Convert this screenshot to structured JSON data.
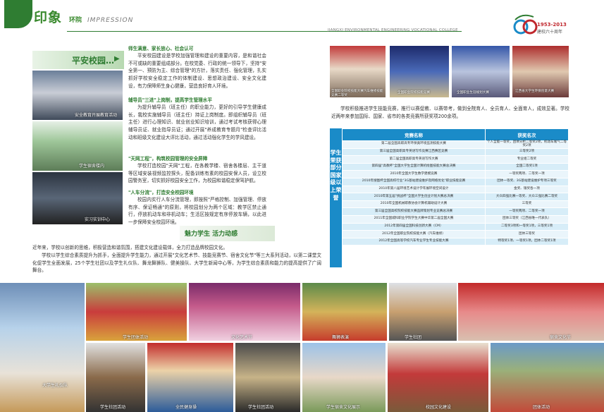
{
  "header": {
    "brand_title": "印象",
    "brand_sub": "环院",
    "brand_impression": "IMPRESSION",
    "college_en": "JIANGXI ENVIRONMENTAL ENGINEERING VOCATIONAL COLLEGE",
    "anniversary_years": "1953-2013",
    "anniversary_text": "建校六十周年"
  },
  "left": {
    "section_heading": "平安校园…",
    "section_arrow": "▶",
    "photo_captions": [
      "安全教育开展教育活动",
      "学生宿舍楼内",
      "实习实训中心"
    ],
    "blocks": [
      {
        "subtitle": "师生满意、家长放心、社会认可",
        "text": "平安校园建设是学校加强管理和建设的重要内容，是和谐社会不可或缺的重要组成部分。在校党委、行政的统一领导下，坚持\"安全第一、预防为主、综合管理\"的方针，落实责任、强化管理，扎实抓好学校安全稳定工作的体制建设、思想政治建设、安全文化建设，有力保障师生身心健康，营造良好育人环境。"
      },
      {
        "subtitle": "辅导员\"三进\"上岗制，提高学生管理水平",
        "text": "为提升辅导员（班主任）的职业能力，更好的引导学生健康成长，我校实施辅导员（班主任）持证上岗制度。即组织辅导员（班主任）进行心理知识、就业创业知识培训，通过考试考核获得心理辅导员证、就业指导员证；通过开展\"养成教育专题月\"检查评比活动和班级文化建设大评比活动，通过活动强化学生的学风建设。"
      },
      {
        "subtitle": "\"天网工程\"，构筑校园管理的安全屏障",
        "text": "学校打造校园\"天网\"工程，在各教学楼、宿舍各楼层、主干道等区域安装视频监控探头，配备训练有素的校园安保人员，设立校园警务室，切实抓好校园安全工作，为校园和谐稳定保驾护航。"
      },
      {
        "subtitle": "\"人车分流\"，打造安全校园环境",
        "text": "校园内实行人车分流管理，即按照\"严格控制、加强管理、停放有序、保证畅通\"的原则，将校园划分为两个区域：教学区禁止通行，停放机动车和非机动车；生活区按规定有序停放车辆，以此进一步保障安全校园环境。"
      }
    ],
    "slogan": "魅力学生 活力动感",
    "bottom_texts": [
      "近年来，学校以创新的思维，积极营造和谐氛围，搭建文化建设载体，全力打造品牌校园文化。",
      "学校以学生综合素质提升为抓手，全面提升学生能力，通过开展\"文化艺术节、技能竞赛节、宿舍文化节\"等三大系列活动，以第二课堂文化促学生全面发展，25个学生社团以及学生礼仪队、舞龙舞狮队、健美操队、大学生新闻中心等，为学生综合素质和能力的提高提供了广阔舞台。"
    ]
  },
  "right": {
    "top_captions": [
      "全国职业院校技能大赛汽车维修技能竞赛二等奖",
      "全国职业院校技能竞赛",
      "全国职业生涯规划大赛",
      "江西省大学生环保创意大赛"
    ],
    "intro": "学校积极推进学生技能竞赛，推行以赛促教、以赛带考，做到全院育人、全员育人、全面育人，成效显著。学校近两年来参加国际、国家、省市的各类竞赛所获奖项200余项。",
    "side_label": "学生荣获部分国家级以上荣誉",
    "table": {
      "headers": [
        "竞赛名称",
        "获奖名次"
      ],
      "rows": [
        [
          "第二届全国高职高专环保类环境监测技能大赛",
          "个人全能一等奖，团体分析二等奖2项，机动车尾气二等奖2项"
        ],
        [
          "第三届全国高职高专英语写作竞赛江西赛区竞赛",
          "三等奖2项"
        ],
        [
          "第二届全国高职高专英语写作大赛",
          "专业组二等奖"
        ],
        [
          "第四届\"高教杯\"全国大学生全国计算机绘图技能大赛总决赛",
          "全国二等奖1项"
        ],
        [
          "2010年全国大学生数学建模竞赛",
          "一等奖两项、二等奖一项"
        ],
        [
          "2010年搜图杯全国高校行业\"3G基站建设维护及网络优化\"职业技能竞赛",
          "团体一等奖、3G基站建设维护专项三等奖"
        ],
        [
          "2010年第八届环境艺术设计学年展环境空间设计",
          "金奖、银奖各一项"
        ],
        [
          "2010年第五届\"挑战杯\"全国大学生创业计划大赛总决赛",
          "大众四强比赛一等奖、大众三强比赛二等奖"
        ],
        [
          "2010年全国机械职教协会计算机辅助设计大赛",
          "三等奖"
        ],
        [
          "第三届全国高校院校技能大赛品牌策划专业竞赛总决赛",
          "一等奖两项、二等奖一项"
        ],
        [
          "2011年全国城科职业学院学生大赛中华第二届全国大赛",
          "团体三等奖（江西省唯一代表队）"
        ],
        [
          "2012年第四届全国科技创新大赛（CM）",
          "二等奖3项和一等奖1项，三等奖1项"
        ],
        [
          "2012年全国职业院校技能大赛（汽车维修）",
          "团体三等奖"
        ],
        [
          "2012年全国高等学校汽车专业学生专业技能大赛",
          "特等奖1项、一等奖1项，团体二等奖1项"
        ]
      ]
    }
  },
  "bottom_photos": {
    "captions": [
      "大学生礼仪队",
      "学生团体活动",
      "文化艺术节",
      "舞狮表演",
      "学生社团",
      "宿舍文化节",
      "学生社团活动",
      "全民健身操",
      "学生社团活动",
      "学生宿舍文化展示",
      "校园文化建设",
      "宿舍文化节",
      "团体活动"
    ]
  },
  "colors": {
    "brand_green": "#2f7d32",
    "table_blue": "#1a8bc8",
    "accent_red": "#c0282e"
  }
}
